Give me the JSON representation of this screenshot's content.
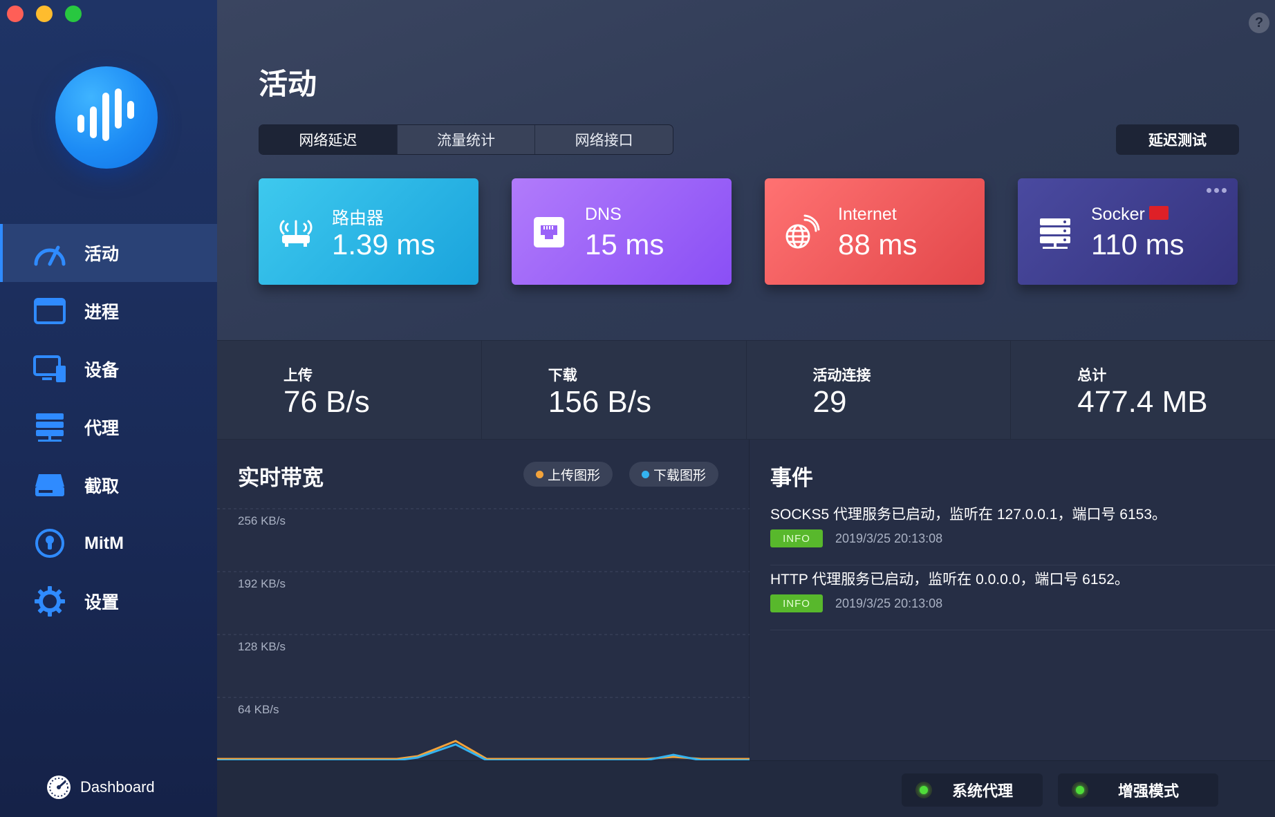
{
  "sidebar": {
    "items": [
      {
        "label": "活动",
        "icon": "gauge-icon",
        "active": true
      },
      {
        "label": "进程",
        "icon": "window-icon",
        "active": false
      },
      {
        "label": "设备",
        "icon": "monitor-icon",
        "active": false
      },
      {
        "label": "代理",
        "icon": "server-icon",
        "active": false
      },
      {
        "label": "截取",
        "icon": "drive-icon",
        "active": false
      },
      {
        "label": "MitM",
        "icon": "lock-circle-icon",
        "active": false
      },
      {
        "label": "设置",
        "icon": "gear-icon",
        "active": false
      }
    ],
    "dashboard_label": "Dashboard"
  },
  "header": {
    "title": "活动",
    "tabs": [
      {
        "label": "网络延迟",
        "active": true
      },
      {
        "label": "流量统计",
        "active": false
      },
      {
        "label": "网络接口",
        "active": false
      }
    ],
    "latency_test_label": "延迟测试",
    "help_label": "?"
  },
  "cards": [
    {
      "title": "路由器",
      "value": "1.39 ms",
      "icon": "router-icon",
      "color": "#2bb5e6"
    },
    {
      "title": "DNS",
      "value": "15 ms",
      "icon": "ethernet-icon",
      "color": "#9a62f8"
    },
    {
      "title": "Internet",
      "value": "88 ms",
      "icon": "globe-wifi-icon",
      "color": "#ef5b5c"
    },
    {
      "title": "Socker",
      "value": "110 ms",
      "icon": "server-icon",
      "color": "#3e3d8e"
    }
  ],
  "stats": [
    {
      "label": "上传",
      "value": "76 B/s"
    },
    {
      "label": "下载",
      "value": "156 B/s"
    },
    {
      "label": "活动连接",
      "value": "29"
    },
    {
      "label": "总计",
      "value": "477.4 MB"
    }
  ],
  "bandwidth": {
    "title": "实时带宽",
    "legend_upload": "上传图形",
    "legend_download": "下载图形",
    "upload_color": "#f3a33b",
    "download_color": "#34b3f0",
    "ticks": [
      "256 KB/s",
      "192 KB/s",
      "128 KB/s",
      "64 KB/s"
    ]
  },
  "events": {
    "title": "事件",
    "items": [
      {
        "message": "SOCKS5 代理服务已启动，监听在 127.0.0.1，端口号 6153。",
        "level": "INFO",
        "time": "2019/3/25 20:13:08"
      },
      {
        "message": "HTTP 代理服务已启动，监听在 0.0.0.0，端口号 6152。",
        "level": "INFO",
        "time": "2019/3/25 20:13:08"
      }
    ]
  },
  "bottom": {
    "system_proxy_label": "系统代理",
    "enhanced_mode_label": "增强模式"
  }
}
